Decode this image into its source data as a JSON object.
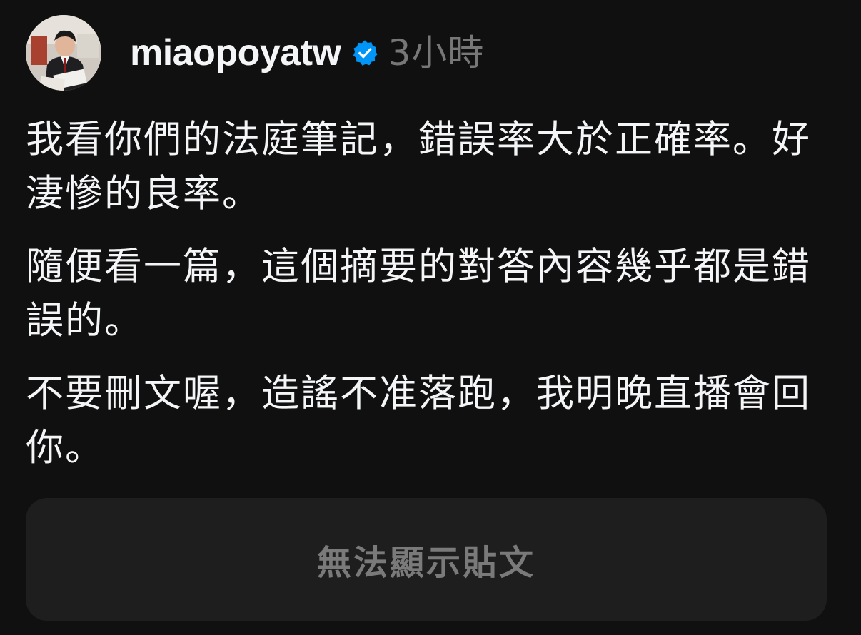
{
  "post": {
    "avatar": {
      "icon": "avatar-photo"
    },
    "username": "miaopoyatw",
    "verified_icon": "verified-badge-icon",
    "verified_color": "#0095f6",
    "timestamp": "3小時",
    "paragraphs": [
      "我看你們的法庭筆記，錯誤率大於正確率。好淒慘的良率。",
      "隨便看一篇，這個摘要的對答內容幾乎都是錯誤的。",
      "不要刪文喔，造謠不准落跑，我明晚直播會回你。"
    ],
    "embedded_post": {
      "text": "無法顯示貼文"
    }
  }
}
